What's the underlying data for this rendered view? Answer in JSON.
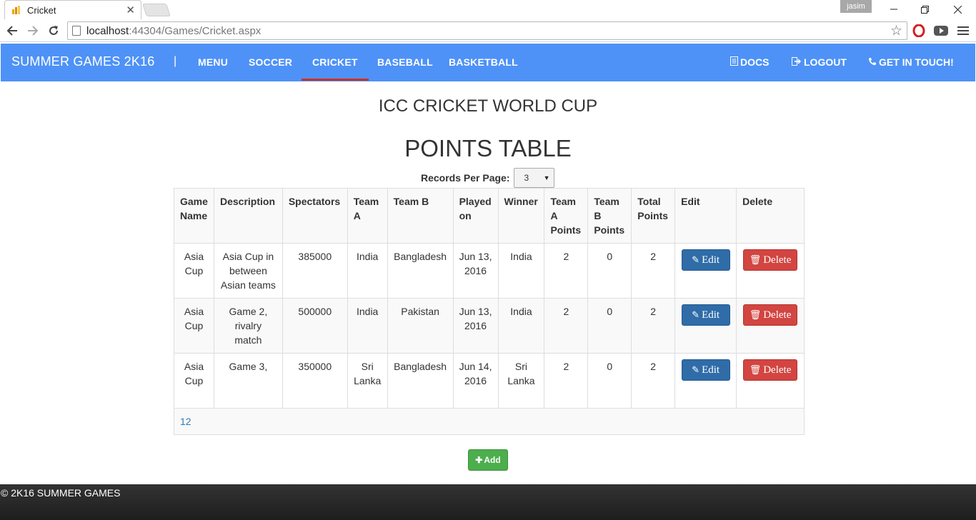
{
  "browser": {
    "tab_title": "Cricket",
    "tab_close": "✕",
    "profile": "jasim",
    "url_host": "localhost",
    "url_path": ":44304/Games/Cricket.aspx"
  },
  "navbar": {
    "brand": "SUMMER GAMES 2K16",
    "separator": "|",
    "links": [
      "MENU",
      "SOCCER",
      "CRICKET",
      "BASEBALL",
      "BASKETBALL"
    ],
    "active": "CRICKET",
    "right": [
      {
        "label": "DOCS",
        "icon": "document-icon"
      },
      {
        "label": "LOGOUT",
        "icon": "logout-icon"
      },
      {
        "label": "GET IN TOUCH!",
        "icon": "phone-icon"
      }
    ]
  },
  "page": {
    "title": "ICC CRICKET WORLD CUP",
    "table_title": "POINTS TABLE",
    "records_label": "Records Per Page:",
    "records_value": "3"
  },
  "table": {
    "headers": [
      "Game Name",
      "Description",
      "Spectators",
      "Team A",
      "Team B",
      "Played on",
      "Winner",
      "Team A Points",
      "Team B Points",
      "Total Points",
      "Edit",
      "Delete"
    ],
    "rows": [
      {
        "game": "Asia Cup",
        "description": "Asia Cup in between Asian teams",
        "spectators": "385000",
        "team_a": "India",
        "team_b": "Bangladesh",
        "played_on": "Jun 13, 2016",
        "winner": "India",
        "a_points": "2",
        "b_points": "0",
        "total": "2"
      },
      {
        "game": "Asia Cup",
        "description": "Game 2, rivalry match",
        "spectators": "500000",
        "team_a": "India",
        "team_b": "Pakistan",
        "played_on": "Jun 13, 2016",
        "winner": "India",
        "a_points": "2",
        "b_points": "0",
        "total": "2"
      },
      {
        "game": "Asia Cup",
        "description": "Game 3,",
        "spectators": "350000",
        "team_a": "Sri Lanka",
        "team_b": "Bangladesh",
        "played_on": "Jun 14, 2016",
        "winner": "Sri Lanka",
        "a_points": "2",
        "b_points": "0",
        "total": "2"
      }
    ],
    "edit_label": "Edit",
    "delete_label": "Delete",
    "pages": [
      "1",
      "2"
    ]
  },
  "add_label": "Add",
  "footer": "© 2K16 SUMMER GAMES",
  "colors": {
    "navbar": "#4e92f7",
    "active_underline": "#c9302c",
    "edit": "#2f6ca8",
    "delete": "#d24541",
    "add": "#4cae4c"
  }
}
